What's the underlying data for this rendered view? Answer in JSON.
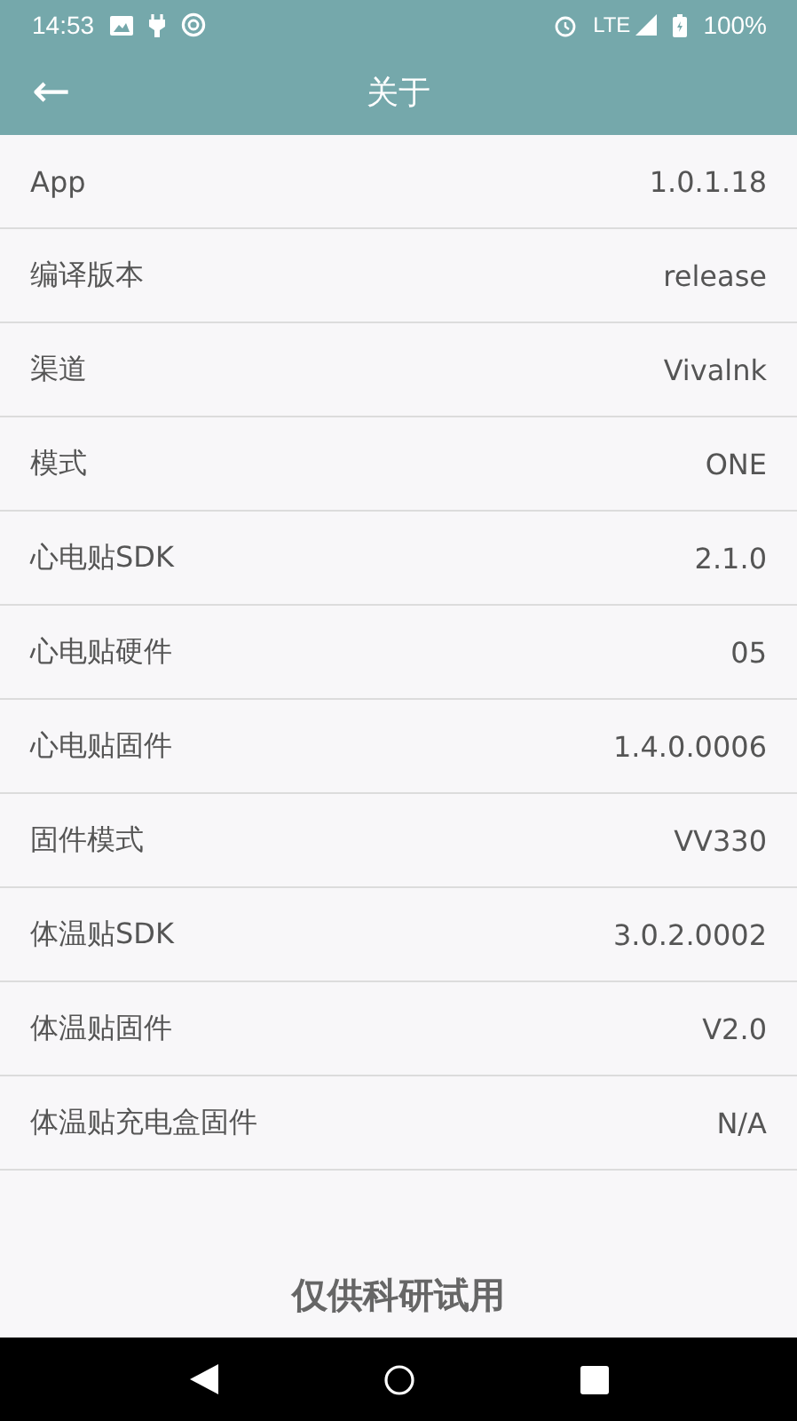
{
  "status_bar": {
    "time": "14:53",
    "network": "LTE",
    "battery": "100%"
  },
  "app_bar": {
    "back": "←",
    "title": "关于"
  },
  "rows": [
    {
      "label": "App",
      "value": "1.0.1.18"
    },
    {
      "label": "编译版本",
      "value": "release"
    },
    {
      "label": "渠道",
      "value": "Vivalnk"
    },
    {
      "label": "模式",
      "value": "ONE"
    },
    {
      "label": "心电贴SDK",
      "value": "2.1.0"
    },
    {
      "label": "心电贴硬件",
      "value": "05"
    },
    {
      "label": "心电贴固件",
      "value": "1.4.0.0006"
    },
    {
      "label": "固件模式",
      "value": "VV330"
    },
    {
      "label": "体温贴SDK",
      "value": "3.0.2.0002"
    },
    {
      "label": "体温贴固件",
      "value": "V2.0"
    },
    {
      "label": "体温贴充电盒固件",
      "value": "N/A"
    }
  ],
  "footer": "仅供科研试用"
}
